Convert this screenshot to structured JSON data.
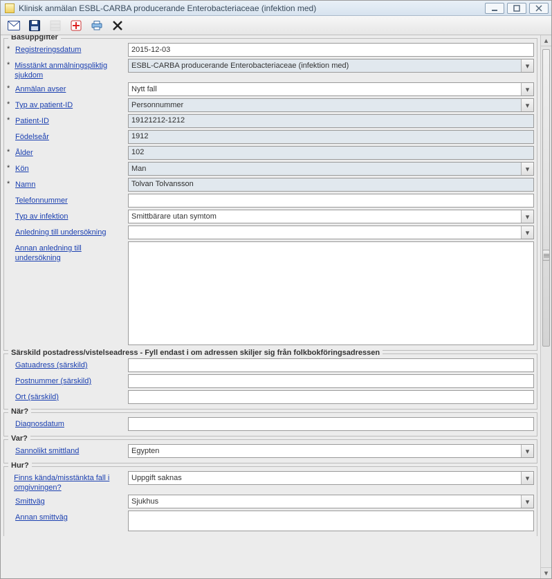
{
  "window": {
    "title": "Klinisk anmälan  ESBL-CARBA producerande Enterobacteriaceae (infektion med)"
  },
  "groups": {
    "bas": {
      "legend": "Basuppgifter",
      "registreringsdatum_label": "Registreringsdatum",
      "registreringsdatum_value": "2015-12-03",
      "sjukdom_label": "Misstänkt anmälningspliktig sjukdom",
      "sjukdom_value": "ESBL-CARBA producerande Enterobacteriaceae (infektion med)",
      "anmalan_label": "Anmälan avser",
      "anmalan_value": "Nytt fall",
      "typid_label": "Typ av patient-ID",
      "typid_value": "Personnummer",
      "patientid_label": "Patient-ID",
      "patientid_value": "19121212-1212",
      "fodelsear_label": "Födelseår",
      "fodelsear_value": "1912",
      "alder_label": "Ålder",
      "alder_value": "102",
      "kon_label": "Kön",
      "kon_value": "Man",
      "namn_label": "Namn",
      "namn_value": "Tolvan Tolvansson",
      "telefon_label": "Telefonnummer",
      "telefon_value": "",
      "infektion_label": "Typ av infektion",
      "infektion_value": "Smittbärare utan symtom",
      "anledning_label": "Anledning till undersökning",
      "anledning_value": "",
      "annan_anledning_label": "Annan anledning till undersökning",
      "annan_anledning_value": ""
    },
    "adress": {
      "legend": "Särskild postadress/vistelseadress - Fyll endast i om adressen skiljer sig från folkbokföringsadressen",
      "gatu_label": "Gatuadress (särskild)",
      "gatu_value": "",
      "postnr_label": "Postnummer (särskild)",
      "postnr_value": "",
      "ort_label": "Ort (särskild)",
      "ort_value": ""
    },
    "nar": {
      "legend": "När?",
      "diagnos_label": "Diagnosdatum",
      "diagnos_value": ""
    },
    "var": {
      "legend": "Var?",
      "smittland_label": "Sannolikt smittland",
      "smittland_value": "Egypten"
    },
    "hur": {
      "legend": "Hur?",
      "kanda_label": "Finns kända/misstänkta fall i omgivningen?",
      "kanda_value": "Uppgift saknas",
      "smittvag_label": "Smittväg",
      "smittvag_value": "Sjukhus",
      "annan_smittvag_label": "Annan smittväg",
      "annan_smittvag_value": ""
    }
  }
}
